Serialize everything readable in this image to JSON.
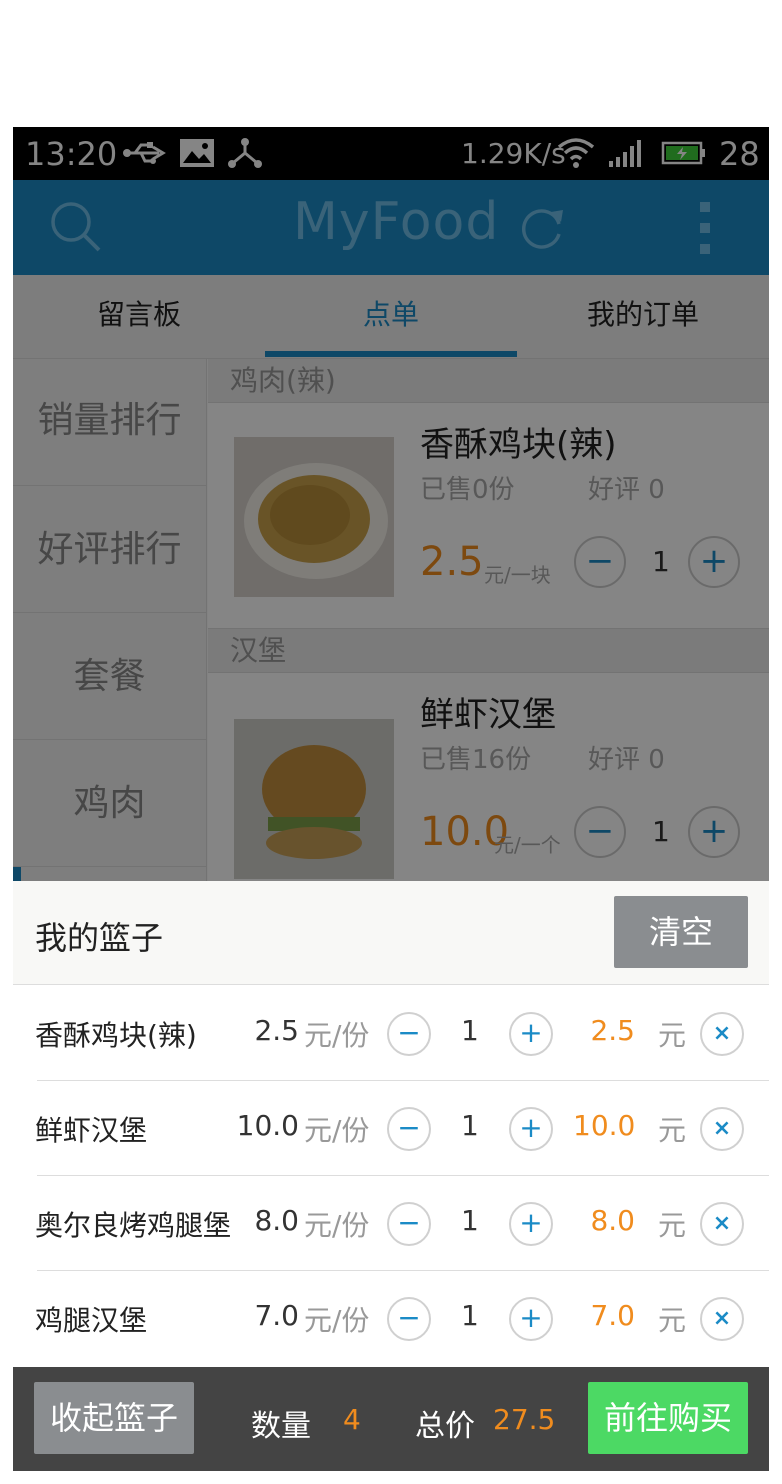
{
  "status_bar": {
    "time": "13:20",
    "net_speed": "1.29K/s",
    "battery": "28",
    "icons": [
      "usb-icon",
      "image-icon",
      "share-icon",
      "wifi-icon",
      "signal-icon",
      "battery-icon"
    ]
  },
  "app_bar": {
    "title": "MyFood",
    "icons": [
      "search-icon",
      "refresh-icon",
      "more-icon"
    ],
    "color": "#1b8bc6"
  },
  "tabs": [
    {
      "label": "留言板"
    },
    {
      "label": "点单",
      "active": true
    },
    {
      "label": "我的订单"
    }
  ],
  "left_nav": [
    "销量排行",
    "好评排行",
    "套餐",
    "鸡肉"
  ],
  "menu": [
    {
      "section": "鸡肉(辣)",
      "name": "香酥鸡块(辣)",
      "sold": "已售0份",
      "rating": "好评 0",
      "price": "2.5",
      "unit": "元/一块",
      "qty": "1"
    },
    {
      "section": "汉堡",
      "name": "鲜虾汉堡",
      "sold": "已售16份",
      "rating": "好评 0",
      "price": "10.0",
      "unit": "元/一个",
      "qty": "1"
    }
  ],
  "basket": {
    "title": "我的篮子",
    "clear_label": "清空",
    "items": [
      {
        "name": "香酥鸡块(辣)",
        "price": "2.5",
        "unit": "元/份",
        "qty": "1",
        "subtotal": "2.5",
        "currency": "元"
      },
      {
        "name": "鲜虾汉堡",
        "price": "10.0",
        "unit": "元/份",
        "qty": "1",
        "subtotal": "10.0",
        "currency": "元"
      },
      {
        "name": "奥尔良烤鸡腿堡",
        "price": "8.0",
        "unit": "元/份",
        "qty": "1",
        "subtotal": "8.0",
        "currency": "元"
      },
      {
        "name": "鸡腿汉堡",
        "price": "7.0",
        "unit": "元/份",
        "qty": "1",
        "subtotal": "7.0",
        "currency": "元"
      }
    ]
  },
  "bottom_bar": {
    "collapse_label": "收起篮子",
    "qty_label": "数量",
    "qty_value": "4",
    "total_label": "总价",
    "total_value": "27.5",
    "checkout_label": "前往购买"
  },
  "colors": {
    "accent": "#1b8bc6",
    "price": "#f08c1e",
    "checkout": "#4cd964",
    "neutral_button": "#8a8d90"
  },
  "symbols": {
    "minus": "−",
    "plus": "+",
    "remove": "×"
  }
}
